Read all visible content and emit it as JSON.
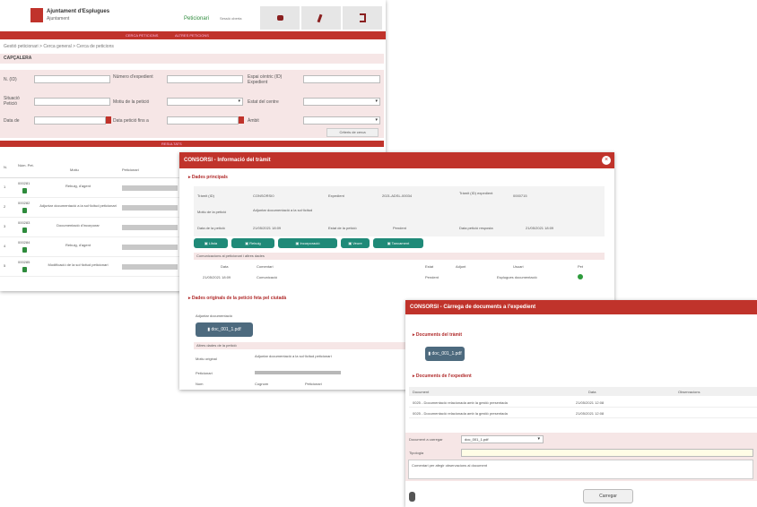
{
  "main": {
    "org_name": "Ajuntament d'Esplugues",
    "org_sub": "Ajuntament",
    "user": "Peticionari",
    "user_meta": "Sessió oberta",
    "breadcrumb": "Gestió peticionari > Cerca general > Cerca de peticions",
    "section_title": "CAPÇALERA",
    "tab_left": "CERCA PETICIONS",
    "tab_right": "ALTRES PETICIONS",
    "form": {
      "f1": "N. (ID)",
      "f2": "Número d'expedient",
      "f3": "Espai cèntric (ID) Expedient",
      "f4": "Situació Petició",
      "f5": "Motiu de la petició",
      "f6": "Estat del centre",
      "f7": "Data de",
      "f8": "Data petició fins a",
      "f9": "Àmbit"
    },
    "search_button": "Criteris de cerca",
    "results_bar": "RESULTATS",
    "table_headers": [
      "N.",
      "Núm. Pet.",
      "Motiu",
      "Peticionari"
    ],
    "rows": [
      {
        "num": "1",
        "pet": "000281",
        "motiu": "Rebuig, d'agent"
      },
      {
        "num": "2",
        "pet": "000282",
        "motiu": "Adjuntar documentació a la sol·licitud peticionari"
      },
      {
        "num": "3",
        "pet": "000283",
        "motiu": "Documentació d'incorporar"
      },
      {
        "num": "4",
        "pet": "000284",
        "motiu": "Rebuig, d'agent"
      },
      {
        "num": "5",
        "pet": "000285",
        "motiu": "Modificació de la sol·licitud peticionari"
      }
    ]
  },
  "dialog1": {
    "title": "CONSORSI - Informació del tràmit",
    "section1": "Dades principals",
    "info": {
      "l1": "Tràmit (ID)",
      "v1": "CONSORSI0",
      "l2": "Expedient",
      "v2": "2021-ADSL-00034",
      "l3": "Tràmit (ID) expedient",
      "v3": "0000715",
      "l4": "Motiu de la petició",
      "v4": "Adjuntar documentació a la sol·licitud",
      "l5": "Data de la petició",
      "v5": "21/05/2021 18:09",
      "l6": "Estat de la petició",
      "v6": "Pendent",
      "l7": "Data petició resposta",
      "v7": "21/05/2021 18:09"
    },
    "buttons": [
      "Llista",
      "Rebuig",
      "Incorporació",
      "Veure",
      "Tancament"
    ],
    "sub_table_title": "Comunicacions al peticionari i altres dades",
    "sub_headers": [
      "Data",
      "Comentari",
      "Estat",
      "Adjunt",
      "Usuari",
      "Pet"
    ],
    "sub_row": [
      "21/05/2021 18:09",
      "Comunicació",
      "Pendent",
      "",
      "Esplugues documentació",
      ""
    ],
    "section2": "Dades originals de la petició feta pel ciutadà",
    "doc_label": "Adjuntar documentació",
    "file_button": "doc_001_1.pdf",
    "detail_title": "Altres dades de la petició",
    "detail_l1": "Motiu original",
    "detail_v1": "Adjuntar documentació a la sol·licitud peticionari",
    "detail_l2": "Peticionari",
    "foot_headers": [
      "Nom",
      "Cognom",
      "Peticionari"
    ]
  },
  "dialog2": {
    "title": "CONSORSI - Càrrega de documents a l'expedient",
    "section1": "Documents del tràmit",
    "file_button": "doc_001_1.pdf",
    "section2": "Documents de l'expedient",
    "table_headers": [
      "Document",
      "Data",
      "Observacions"
    ],
    "rows": [
      {
        "doc": "0025 - Documentació relacionada amb la gestió presentada",
        "date": "21/05/2021 12:08"
      },
      {
        "doc": "0025 - Documentació relacionada amb la gestió presentada",
        "date": "21/05/2021 12:08"
      }
    ],
    "select_label": "Document a carregar",
    "select_value": "doc_001_1.pdf",
    "name_label": "Tipologia",
    "comment_text": "Comentari per afegir observacions al document",
    "save_button": "Carregar"
  },
  "colors": {
    "accent": "#c0332b",
    "teal": "#1f8a78",
    "slate": "#4d6a7e"
  }
}
